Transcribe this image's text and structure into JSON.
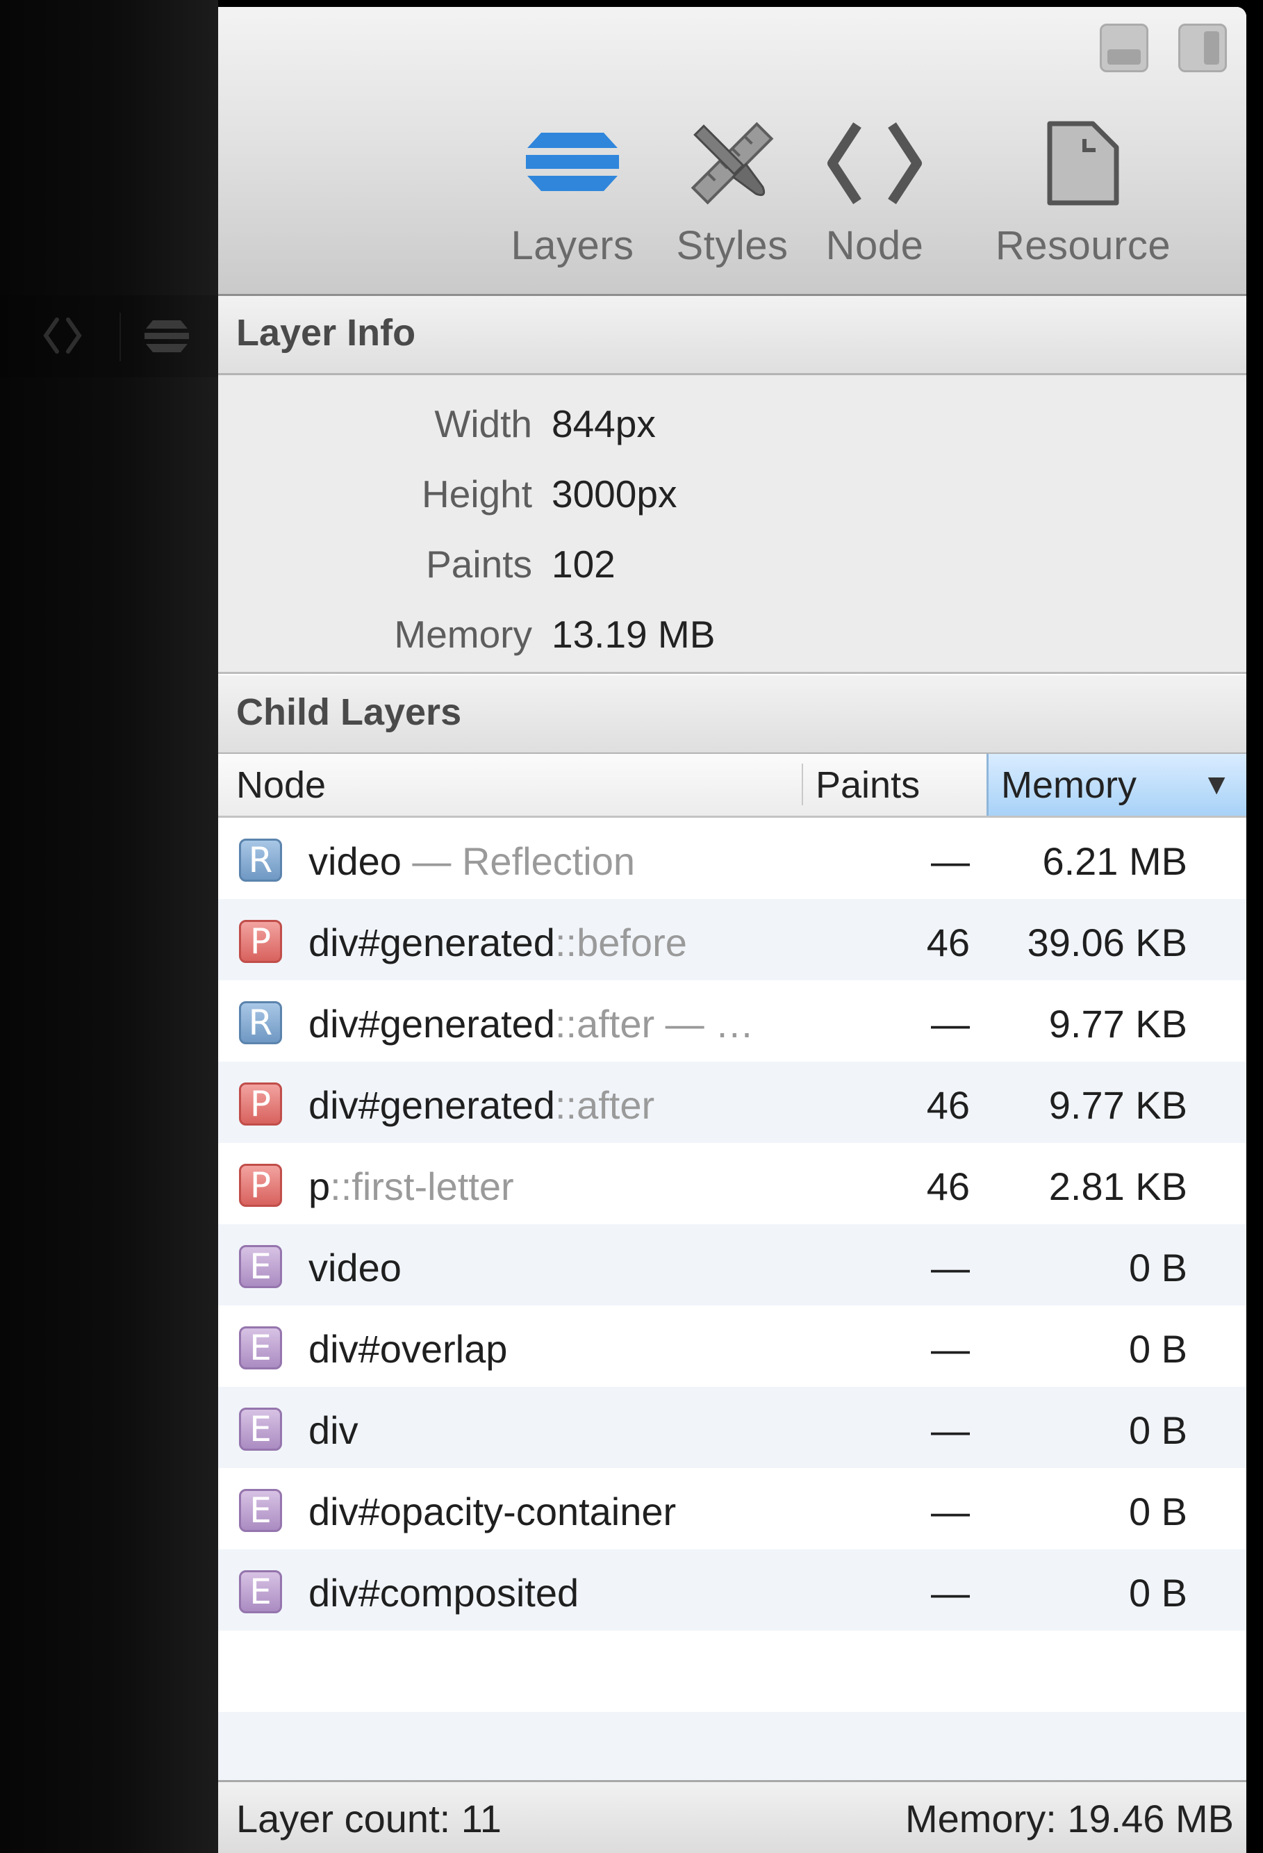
{
  "toolbar": {
    "tabs": [
      {
        "label": "Layers",
        "icon": "layers-icon"
      },
      {
        "label": "Styles",
        "icon": "brush-ruler-icon"
      },
      {
        "label": "Node",
        "icon": "code-brackets-icon"
      },
      {
        "label": "Resource",
        "icon": "document-icon"
      }
    ],
    "selected_tab": "Layers",
    "accent": "#3a8fe0"
  },
  "layer_info": {
    "title": "Layer Info",
    "rows": [
      {
        "key": "Width",
        "value": "844px"
      },
      {
        "key": "Height",
        "value": "3000px"
      },
      {
        "key": "Paints",
        "value": "102"
      },
      {
        "key": "Memory",
        "value": "13.19 MB"
      }
    ]
  },
  "child_layers": {
    "title": "Child Layers",
    "columns": {
      "node": "Node",
      "paints": "Paints",
      "memory": "Memory",
      "sort_indicator": "▼"
    },
    "rows": [
      {
        "badge": "R",
        "name": "video",
        "suffix": " — Reflection",
        "paints": "—",
        "memory": "6.21 MB"
      },
      {
        "badge": "P",
        "name": "div#generated",
        "suffix": "::before",
        "paints": "46",
        "memory": "39.06 KB"
      },
      {
        "badge": "R",
        "name": "div#generated",
        "suffix": "::after — …",
        "paints": "—",
        "memory": "9.77 KB"
      },
      {
        "badge": "P",
        "name": "div#generated",
        "suffix": "::after",
        "paints": "46",
        "memory": "9.77 KB"
      },
      {
        "badge": "P",
        "name": "p",
        "suffix": "::first-letter",
        "paints": "46",
        "memory": "2.81 KB"
      },
      {
        "badge": "E",
        "name": "video",
        "suffix": "",
        "paints": "—",
        "memory": "0 B"
      },
      {
        "badge": "E",
        "name": "div#overlap",
        "suffix": "",
        "paints": "—",
        "memory": "0 B"
      },
      {
        "badge": "E",
        "name": "div",
        "suffix": "",
        "paints": "—",
        "memory": "0 B"
      },
      {
        "badge": "E",
        "name": "div#opacity-container",
        "suffix": "",
        "paints": "—",
        "memory": "0 B"
      },
      {
        "badge": "E",
        "name": "div#composited",
        "suffix": "",
        "paints": "—",
        "memory": "0 B"
      }
    ]
  },
  "footer": {
    "layer_count": "Layer count: 11",
    "memory": "Memory: 19.46 MB"
  }
}
